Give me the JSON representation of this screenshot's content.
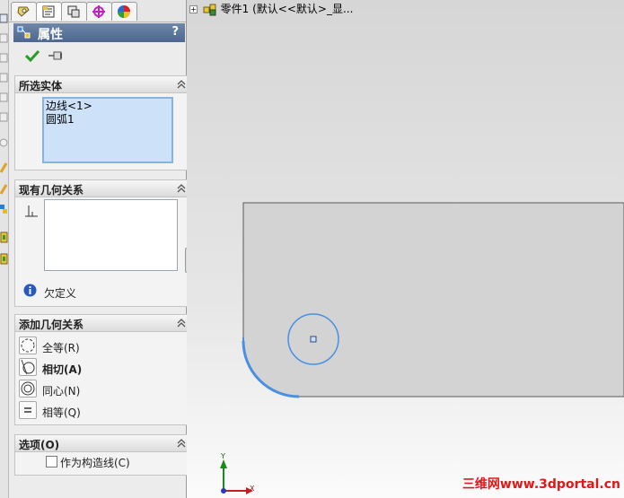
{
  "pm_tabs": [
    {
      "name": "featuremanager-tab",
      "icon": "feature-tree-icon"
    },
    {
      "name": "propertymanager-tab",
      "icon": "property-manager-icon"
    },
    {
      "name": "configurationmanager-tab",
      "icon": "configuration-icon"
    },
    {
      "name": "dimxpert-tab",
      "icon": "dimxpert-icon"
    },
    {
      "name": "display-manager-tab",
      "icon": "appearance-icon"
    }
  ],
  "panel": {
    "title": "属性",
    "help": "?"
  },
  "selected_entities": {
    "header": "所选实体",
    "items": [
      "边线<1>",
      "圆弧1"
    ]
  },
  "existing_relations": {
    "header": "现有几何关系",
    "status": "欠定义"
  },
  "add_relations": {
    "header": "添加几何关系",
    "items": [
      {
        "label": "全等(R)",
        "icon": "coradial-icon",
        "bold": false
      },
      {
        "label": "相切(A)",
        "icon": "tangent-icon",
        "bold": true
      },
      {
        "label": "同心(N)",
        "icon": "concentric-icon",
        "bold": false
      },
      {
        "label": "相等(Q)",
        "icon": "equal-icon",
        "bold": false
      }
    ]
  },
  "options": {
    "header": "选项(O)",
    "construction_label": "作为构造线(C)",
    "construction_checked": false
  },
  "tree": {
    "expander": "+",
    "part_name": "零件1",
    "config_text": "(默认<<默认>_显..."
  },
  "triad": {
    "y_label": "Y",
    "x_label": "X"
  },
  "watermark": "三维网www.3dportal.cn",
  "colors": {
    "arc_highlight": "#4a90e2",
    "title_bar": "#5a729a",
    "selection_bg": "#cde2f8",
    "watermark": "#e01818"
  }
}
